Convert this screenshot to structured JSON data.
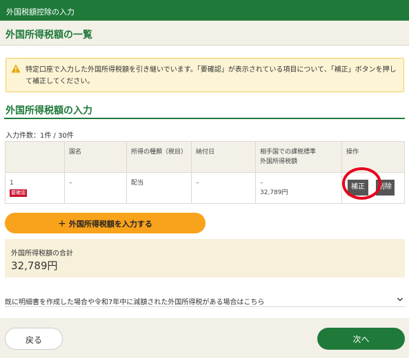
{
  "topbar": {
    "title": "外国税額控除の入力"
  },
  "page": {
    "title": "外国所得税額の一覧"
  },
  "notice": {
    "icon": "warning-icon",
    "text": "特定口座で入力した外国所得税額を引き継いでいます。「要確認」が表示されている項目について、「補正」ボタンを押して補正してください。"
  },
  "section": {
    "title": "外国所得税額の入力"
  },
  "count": "入力件数：1件 / 30件",
  "table": {
    "headers": {
      "no": "",
      "country": "国名",
      "income_type": "所得の種類（税目）",
      "payment_date": "納付日",
      "amount_line1": "相手国での課税標準",
      "amount_line2": "外国所得税額",
      "actions": "操作"
    },
    "rows": [
      {
        "no": "1",
        "badge": "要確認",
        "country": "–",
        "income_type": "配当",
        "payment_date": "–",
        "tax_base": "–",
        "tax_amount": "32,789円",
        "fix_label": "補正",
        "delete_label": "削除"
      }
    ]
  },
  "add_button": {
    "icon": "plus-icon",
    "label": "外国所得税額を入力する"
  },
  "total": {
    "label": "外国所得税額の合計",
    "value": "32,789円"
  },
  "accordion": {
    "text": "既に明細書を作成した場合や令和7年中に減額された外国所得税がある場合はこちら",
    "icon": "chevron-down-icon"
  },
  "nav": {
    "back_label": "戻る",
    "next_label": "次へ"
  },
  "colors": {
    "brand_green": "#1f7a3a",
    "accent_orange": "#f9a21b",
    "badge_red": "#c8102e",
    "highlight_ring": "#e8001c"
  }
}
